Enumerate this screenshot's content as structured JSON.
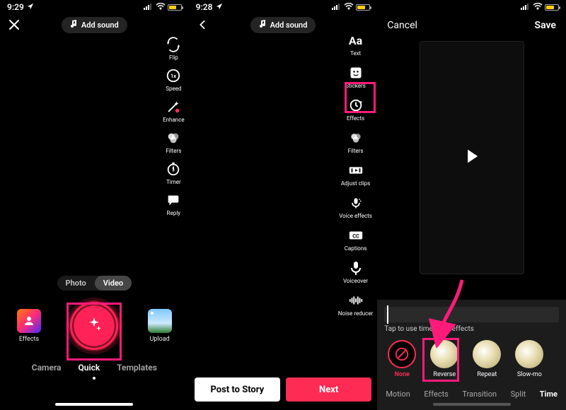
{
  "status": {
    "time1": "9:29",
    "time2": "9:28",
    "signal": "•ıl",
    "wifi": "⌇",
    "battery_percent": 55
  },
  "screen1": {
    "add_sound": "Add sound",
    "mode_photo": "Photo",
    "mode_video": "Video",
    "effects_label": "Effects",
    "upload_label": "Upload",
    "tabs": {
      "camera": "Camera",
      "quick": "Quick",
      "templates": "Templates"
    },
    "side_tools": [
      {
        "id": "flip",
        "label": "Flip"
      },
      {
        "id": "speed",
        "label": "Speed"
      },
      {
        "id": "enhance",
        "label": "Enhance"
      },
      {
        "id": "filters",
        "label": "Filters"
      },
      {
        "id": "timer",
        "label": "Timer"
      },
      {
        "id": "reply",
        "label": "Reply"
      }
    ]
  },
  "screen2": {
    "add_sound": "Add sound",
    "post_to_story": "Post to Story",
    "next": "Next",
    "side_tools": [
      {
        "id": "text",
        "label": "Text"
      },
      {
        "id": "stickers",
        "label": "Stickers"
      },
      {
        "id": "effects",
        "label": "Effects"
      },
      {
        "id": "filters",
        "label": "Filters"
      },
      {
        "id": "adjust_clips",
        "label": "Adjust clips"
      },
      {
        "id": "voice_effects",
        "label": "Voice effects"
      },
      {
        "id": "captions",
        "label": "Captions"
      },
      {
        "id": "voiceover",
        "label": "Voiceover"
      },
      {
        "id": "noise_reducer",
        "label": "Noise reducer"
      }
    ]
  },
  "screen3": {
    "cancel": "Cancel",
    "save": "Save",
    "hint": "Tap to use time warp effects",
    "effects": [
      {
        "id": "none",
        "label": "None"
      },
      {
        "id": "reverse",
        "label": "Reverse"
      },
      {
        "id": "repeat",
        "label": "Repeat"
      },
      {
        "id": "slowmo",
        "label": "Slow-mo"
      }
    ],
    "tabs": {
      "motion": "Motion",
      "effects": "Effects",
      "transition": "Transition",
      "split": "Split",
      "time": "Time"
    }
  }
}
